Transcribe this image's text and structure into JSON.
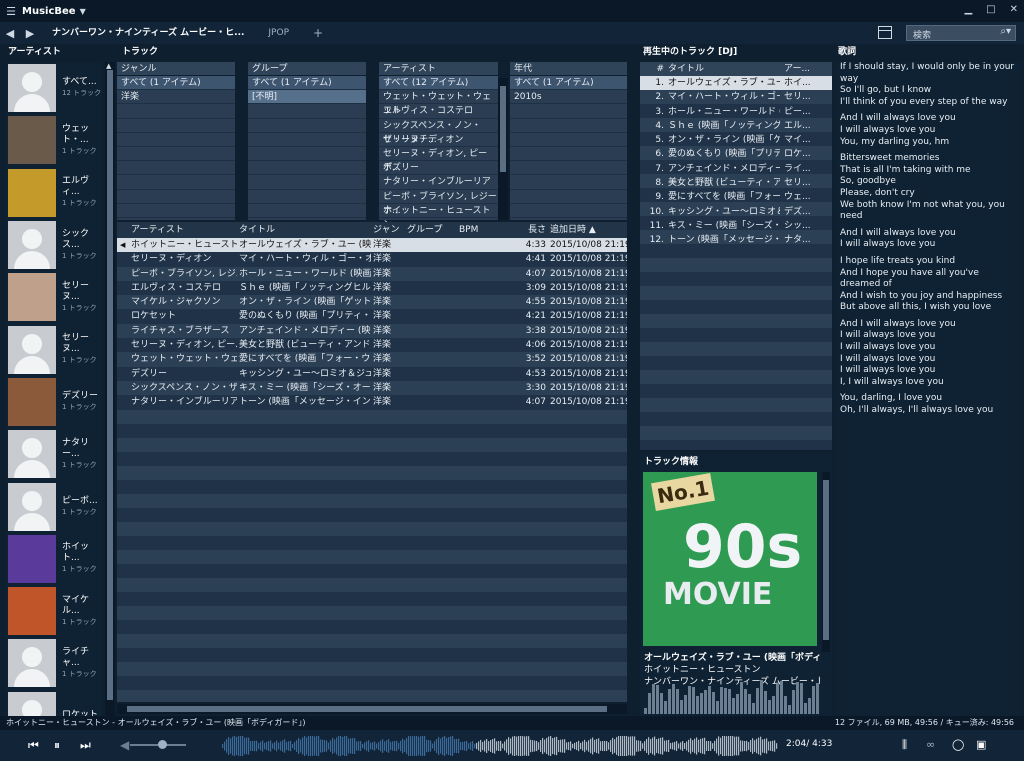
{
  "app": {
    "title": "MusicBee"
  },
  "tabs": [
    {
      "label": "ナンバーワン・ナインティーズ ムービー・ヒ..."
    },
    {
      "label": "JPOP"
    }
  ],
  "search": {
    "placeholder": "検索"
  },
  "headers": {
    "artists": "アーティスト",
    "tracks": "トラック",
    "now_playing": "再生中のトラック [DJ]",
    "lyrics": "歌詞",
    "track_info": "トラック情報"
  },
  "artists": [
    {
      "name": "すべて...",
      "count": "12 トラック",
      "photo": false
    },
    {
      "name": "ウェット・...",
      "count": "1 トラック",
      "photo": true
    },
    {
      "name": "エルヴィ...",
      "count": "1 トラック",
      "photo": true
    },
    {
      "name": "シックス...",
      "count": "1 トラック",
      "photo": false
    },
    {
      "name": "セリーヌ...",
      "count": "1 トラック",
      "photo": true
    },
    {
      "name": "セリーヌ...",
      "count": "1 トラック",
      "photo": false
    },
    {
      "name": "デズリー",
      "count": "1 トラック",
      "photo": true
    },
    {
      "name": "ナタリー...",
      "count": "1 トラック",
      "photo": false
    },
    {
      "name": "ピーボ...",
      "count": "1 トラック",
      "photo": false
    },
    {
      "name": "ホイット...",
      "count": "1 トラック",
      "photo": true
    },
    {
      "name": "マイケル...",
      "count": "1 トラック",
      "photo": true
    },
    {
      "name": "ライチャ...",
      "count": "1 トラック",
      "photo": false
    },
    {
      "name": "ロケット",
      "count": "",
      "photo": false
    }
  ],
  "filters": {
    "genre": {
      "header": "ジャンル",
      "items": [
        "すべて (1 アイテム)",
        "洋楽"
      ]
    },
    "group": {
      "header": "グループ",
      "items": [
        "すべて (1 アイテム)",
        "[不明]"
      ]
    },
    "artist": {
      "header": "アーティスト",
      "items": [
        "すべて (12 アイテム)",
        "ウェット・ウェット・ウェット",
        "エルヴィス・コステロ",
        "シックスペンス・ノン・ザ・リッチ...",
        "セリーヌ・ディオン",
        "セリーヌ・ディオン, ピーボ...",
        "デズリー",
        "ナタリー・インブルーリア",
        "ピーボ・ブライソン, レジーナ...",
        "ホイットニー・ヒューストン"
      ]
    },
    "year": {
      "header": "年代",
      "items": [
        "すべて (1 アイテム)",
        "2010s"
      ]
    }
  },
  "track_columns": [
    "アーティスト",
    "タイトル",
    "ジャンル",
    "グループ",
    "BPM",
    "長さ",
    "追加日時 ▲"
  ],
  "tracks": [
    [
      "ホイットニー・ヒューストン",
      "オールウェイズ・ラブ・ユー (映画「...",
      "洋楽",
      "",
      "",
      "4:33",
      "2015/10/08 21:19"
    ],
    [
      "セリーヌ・ディオン",
      "マイ・ハート・ウィル・ゴー・オン (映...",
      "洋楽",
      "",
      "",
      "4:41",
      "2015/10/08 21:19"
    ],
    [
      "ピーボ・ブライソン, レジ...",
      "ホール・ニュー・ワールド (映画「ア...",
      "洋楽",
      "",
      "",
      "4:07",
      "2015/10/08 21:19"
    ],
    [
      "エルヴィス・コステロ",
      "Ｓｈｅ (映画「ノッティングヒルの...",
      "洋楽",
      "",
      "",
      "3:09",
      "2015/10/08 21:19"
    ],
    [
      "マイケル・ジャクソン",
      "オン・ザ・ライン (映画「ゲット・オン...",
      "洋楽",
      "",
      "",
      "4:55",
      "2015/10/08 21:19"
    ],
    [
      "ロケセット",
      "愛のぬくもり (映画「プリティ・ウー...",
      "洋楽",
      "",
      "",
      "4:21",
      "2015/10/08 21:19"
    ],
    [
      "ライチャス・ブラザース",
      "アンチェインド・メロディー (映画「...",
      "洋楽",
      "",
      "",
      "3:38",
      "2015/10/08 21:19"
    ],
    [
      "セリーヌ・ディオン, ピー...",
      "美女と野獣 (ビューティ・アンド・...",
      "洋楽",
      "",
      "",
      "4:06",
      "2015/10/08 21:19"
    ],
    [
      "ウェット・ウェット・ウェット",
      "愛にすべてを (映画「フォー・ウェ...",
      "洋楽",
      "",
      "",
      "3:52",
      "2015/10/08 21:19"
    ],
    [
      "デズリー",
      "キッシング・ユー～ロミオ＆ジュリエ...",
      "洋楽",
      "",
      "",
      "4:53",
      "2015/10/08 21:19"
    ],
    [
      "シックスペンス・ノン・ザ・リ...",
      "キス・ミー (映画「シーズ・オール・...",
      "洋楽",
      "",
      "",
      "3:30",
      "2015/10/08 21:19"
    ],
    [
      "ナタリー・インブルーリア",
      "トーン (映画「メッセージ・イン・ア...",
      "洋楽",
      "",
      "",
      "4:07",
      "2015/10/08 21:19"
    ]
  ],
  "now_playing_columns": [
    "#",
    "タイトル",
    "アー..."
  ],
  "now_playing": [
    {
      "n": "1.",
      "title": "オールウェイズ・ラブ・ユー (...",
      "artist": "ホイ..."
    },
    {
      "n": "2.",
      "title": "マイ・ハート・ウィル・ゴー・オン...",
      "artist": "セリ..."
    },
    {
      "n": "3.",
      "title": "ホール・ニュー・ワールド (映画...",
      "artist": "ピー..."
    },
    {
      "n": "4.",
      "title": "Ｓｈｅ (映画「ノッティング...",
      "artist": "エル..."
    },
    {
      "n": "5.",
      "title": "オン・ザ・ライン (映画「ゲット...",
      "artist": "マイ..."
    },
    {
      "n": "6.",
      "title": "愛のぬくもり (映画「プリティ...",
      "artist": "ロケ..."
    },
    {
      "n": "7.",
      "title": "アンチェインド・メロディー (...",
      "artist": "ライ..."
    },
    {
      "n": "8.",
      "title": "美女と野獣 (ビューティ・ア...",
      "artist": "セリ..."
    },
    {
      "n": "9.",
      "title": "愛にすべてを (映画「フォー...",
      "artist": "ウェ..."
    },
    {
      "n": "10.",
      "title": "キッシング・ユー～ロミオ＆ジ...",
      "artist": "デズ..."
    },
    {
      "n": "11.",
      "title": "キス・ミー (映画「シーズ・オ...",
      "artist": "シッ..."
    },
    {
      "n": "12.",
      "title": "トーン (映画「メッセージ・イ...",
      "artist": "ナタ..."
    }
  ],
  "track_info": {
    "title": "オールウェイズ・ラブ・ユー (映画「ボディガー...",
    "artist": "ホイットニー・ヒューストン",
    "album": "ナンバーワン・ナインティーズ ムービー・ヒッツ D...",
    "cover_text_1": "No.1",
    "cover_text_2": "90s",
    "cover_text_3": "MOVIE"
  },
  "lyrics": [
    "If I should stay, I would only be in your way\nSo I'll go, but I know\nI'll think of you every step of the way",
    "And I will always love you\nI will always love you\nYou, my darling you, hm",
    "Bittersweet memories\nThat is all I'm taking with me\nSo, goodbye\nPlease, don't cry\nWe both know I'm not what you, you need",
    "And I will always love you\nI will always love you",
    "I hope life treats you kind\nAnd I hope you have all you've dreamed of\nAnd I wish to you joy and happiness\nBut above all this, I wish you love",
    "And I will always love you\nI will always love you\nI will always love you\nI will always love you\nI will always love you\nI, I will always love you",
    "You, darling, I love you\nOh, I'll always, I'll always love you"
  ],
  "status": {
    "left": "ホイットニー・ヒューストン - オールウェイズ・ラブ・ユー (映画「ボディガード」)",
    "right": "12 ファイル, 69 MB, 49:56 /    キュー済み: 49:56"
  },
  "player": {
    "time": "2:04/ 4:33",
    "progress": 0.455,
    "volume": 0.5
  },
  "colors": {
    "accent": "#3e5570",
    "selected": "#d8dee5",
    "background": "#0e1f30"
  }
}
